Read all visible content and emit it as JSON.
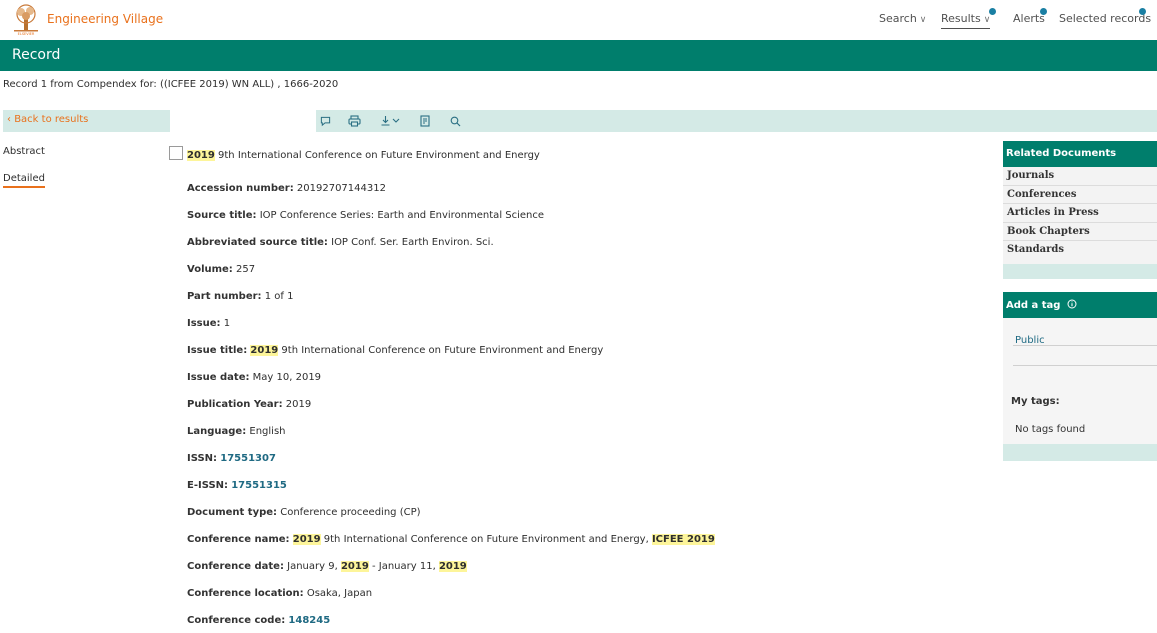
{
  "header": {
    "brand": "Engineering Village",
    "nav": {
      "search": "Search",
      "results": "Results",
      "alerts": "Alerts",
      "selected_records": "Selected records"
    }
  },
  "record_bar": {
    "title": "Record"
  },
  "crumb": "Record 1 from Compendex for: ((ICFEE 2019) WN ALL) , 1666-2020",
  "back_link": "Back to results",
  "tabs": {
    "abstract": "Abstract",
    "detailed": "Detailed"
  },
  "document": {
    "title_highlight": "2019",
    "title_rest": " 9th International Conference on Future Environment and Energy",
    "fields": {
      "accession": {
        "label": "Accession number:",
        "value": " 20192707144312"
      },
      "source_title": {
        "label": "Source title:",
        "value": " IOP Conference Series: Earth and Environmental Science"
      },
      "abbrev_source": {
        "label": "Abbreviated source title:",
        "value": " IOP Conf. Ser. Earth Environ. Sci."
      },
      "volume": {
        "label": "Volume:",
        "value": " 257"
      },
      "part_number": {
        "label": "Part number:",
        "value": " 1 of 1"
      },
      "issue": {
        "label": "Issue:",
        "value": " 1"
      },
      "issue_title": {
        "label": "Issue title:",
        "hl": "2019",
        "value": " 9th International Conference on Future Environment and Energy"
      },
      "issue_date": {
        "label": "Issue date:",
        "value": " May 10, 2019"
      },
      "pub_year": {
        "label": "Publication Year:",
        "value": " 2019"
      },
      "language": {
        "label": "Language:",
        "value": " English"
      },
      "issn": {
        "label": "ISSN:",
        "value": "17551307"
      },
      "eissn": {
        "label": "E-ISSN:",
        "value": "17551315"
      },
      "doc_type": {
        "label": "Document type:",
        "value": " Conference proceeding (CP)"
      },
      "conf_name": {
        "label": "Conference name:",
        "hl": "2019",
        "value": " 9th International Conference on Future Environment and Energy, ",
        "hl2": "ICFEE 2019"
      },
      "conf_date": {
        "label": "Conference date:",
        "value1": " January 9, ",
        "hl": "2019",
        "value2": " - January 11, ",
        "hl2": "2019"
      },
      "conf_location": {
        "label": "Conference location:",
        "value": " Osaka, Japan"
      },
      "conf_code": {
        "label": "Conference code:",
        "value": "148245"
      }
    }
  },
  "related": {
    "heading": "Related Documents",
    "items": [
      "Journals",
      "Conferences",
      "Articles in Press",
      "Book Chapters",
      "Standards"
    ]
  },
  "tags": {
    "heading": "Add a tag",
    "public": "Public",
    "my_tags": "My tags:",
    "none": "No tags found"
  },
  "colors": {
    "accent_green": "#007e6c",
    "light_teal": "#d4eae6",
    "orange": "#e9711c",
    "link": "#1f6a83",
    "highlight": "#fdf59a"
  }
}
